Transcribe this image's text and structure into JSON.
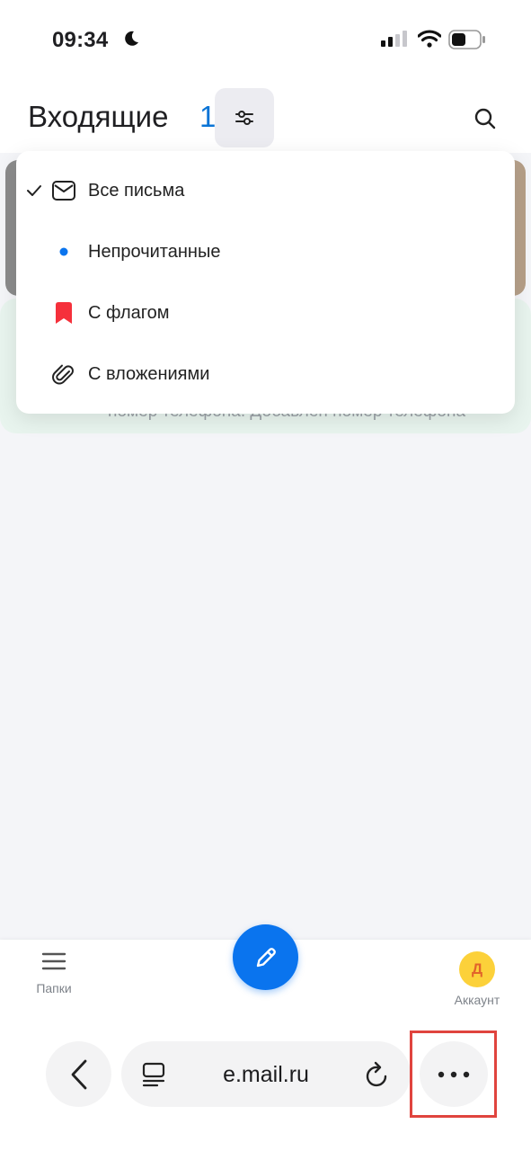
{
  "status_bar": {
    "time": "09:34",
    "icons": [
      "moon-icon",
      "cellular-signal-icon",
      "wifi-icon",
      "battery-icon"
    ]
  },
  "header": {
    "title": "Входящие",
    "count": "1",
    "filter_icon": "sliders-icon",
    "search_icon": "search-icon"
  },
  "background_content": {
    "obscured_preview_text": "номер телефона. Добавлен номер телефона"
  },
  "filter_menu": {
    "items": [
      {
        "label": "Все письма",
        "icon": "envelope-icon",
        "selected": true
      },
      {
        "label": "Непрочитанные",
        "icon": "unread-dot-icon",
        "selected": false
      },
      {
        "label": "С флагом",
        "icon": "flag-icon",
        "selected": false
      },
      {
        "label": "С вложениями",
        "icon": "paperclip-icon",
        "selected": false
      }
    ]
  },
  "bottom_nav": {
    "folders_label": "Папки",
    "compose_icon": "pencil-icon",
    "account_label": "Аккаунт",
    "avatar_letter": "Д"
  },
  "browser": {
    "url": "e.mail.ru",
    "back_icon": "chevron-left-icon",
    "reader_icon": "reader-icon",
    "reload_icon": "reload-icon",
    "more_icon": "more-dots-icon"
  },
  "colors": {
    "accent": "#0a74ee",
    "flag": "#f5303b",
    "avatar_bg": "#fcd13a",
    "highlight": "#e0443e"
  }
}
